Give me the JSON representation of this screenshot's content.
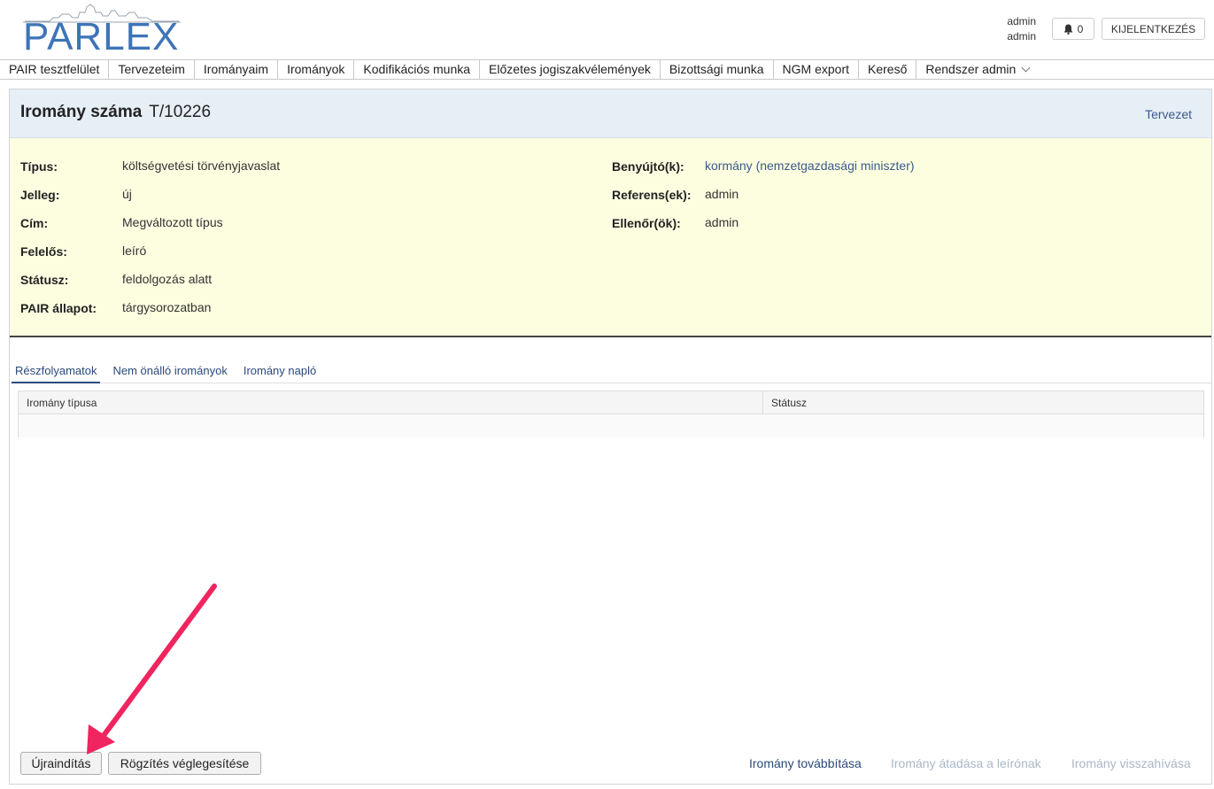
{
  "header": {
    "logo_text": "PARLEX",
    "user_name": "admin",
    "user_role": "admin",
    "notifications_count": "0",
    "logout_label": "KIJELENTKEZÉS"
  },
  "nav": {
    "items": [
      {
        "label": "PAIR tesztfelület"
      },
      {
        "label": "Tervezeteim"
      },
      {
        "label": "Irományaim"
      },
      {
        "label": "Irományok"
      },
      {
        "label": "Kodifikációs munka"
      },
      {
        "label": "Előzetes jogiszakvélemények"
      },
      {
        "label": "Bizottsági munka"
      },
      {
        "label": "NGM export"
      },
      {
        "label": "Kereső"
      },
      {
        "label": "Rendszer admin"
      }
    ]
  },
  "document": {
    "title_label": "Iromány száma",
    "number": "T/10226",
    "status_link": "Tervezet"
  },
  "details_left": [
    {
      "label": "Típus:",
      "value": "költségvetési törvényjavaslat"
    },
    {
      "label": "Jelleg:",
      "value": "új"
    },
    {
      "label": "Cím:",
      "value": "Megváltozott típus"
    },
    {
      "label": "Felelős:",
      "value": "leíró"
    },
    {
      "label": "Státusz:",
      "value": "feldolgozás alatt"
    },
    {
      "label": "PAIR állapot:",
      "value": "tárgysorozatban"
    }
  ],
  "details_right": [
    {
      "label": "Benyújtó(k):",
      "value": "kormány (nemzetgazdasági miniszter)"
    },
    {
      "label": "Referens(ek):",
      "value": "admin"
    },
    {
      "label": "Ellenőr(ök):",
      "value": "admin"
    }
  ],
  "tabs": [
    {
      "label": "Részfolyamatok",
      "active": true
    },
    {
      "label": "Nem önálló irományok",
      "active": false
    },
    {
      "label": "Iromány napló",
      "active": false
    }
  ],
  "table": {
    "columns": [
      "Iromány típusa",
      "Státusz"
    ],
    "rows": []
  },
  "footer": {
    "restart_label": "Újraindítás",
    "finalize_label": "Rögzítés véglegesítése",
    "forward_label": "Iromány továbbítása",
    "handover_label": "Iromány átadása a leírónak",
    "withdraw_label": "Iromány visszahívása"
  },
  "colors": {
    "brand": "#3e74b8",
    "link": "#2a4a7c",
    "header_bg": "#e6eef6",
    "info_bg": "#fdfde0",
    "annotation_arrow": "#f0245f"
  }
}
